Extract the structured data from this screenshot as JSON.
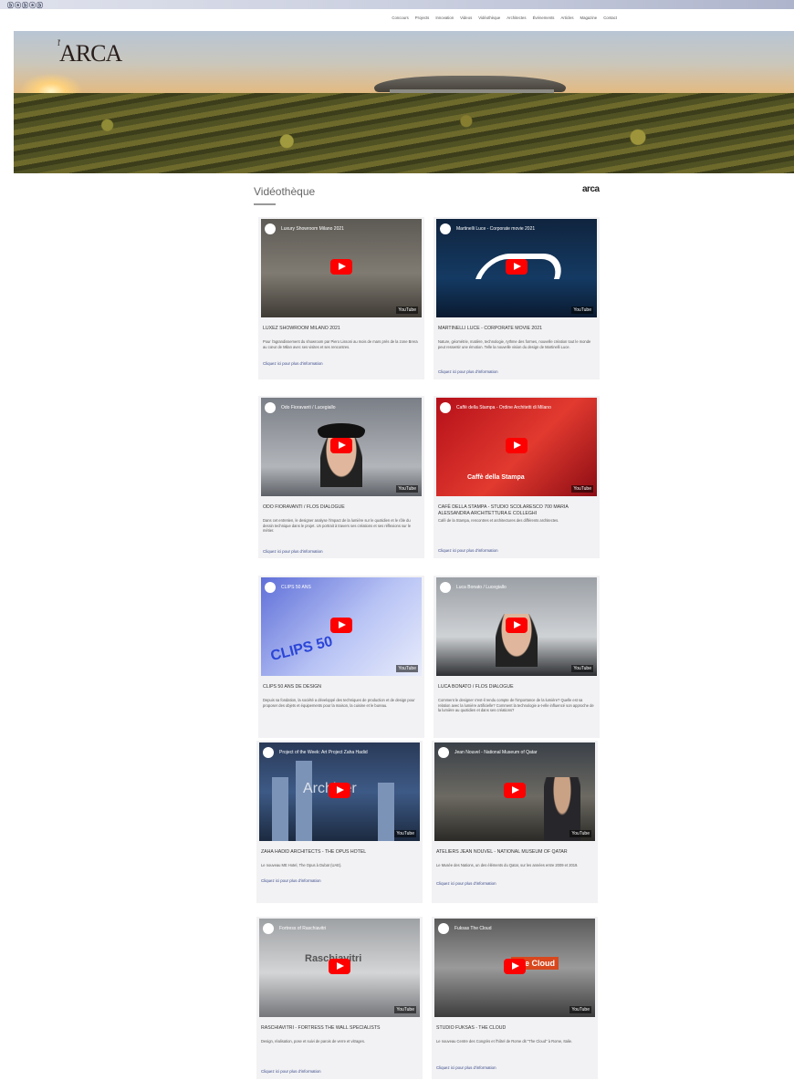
{
  "site": {
    "top_logo": "ⓑⓐⓑⓐⓑ",
    "logo_prefix": "l'",
    "logo": "ARCA",
    "nav": [
      "Concours",
      "Projects",
      "Innovation",
      "Videos",
      "Vidéothèque",
      "Architectes",
      "Événements",
      "Articles",
      "Magazine",
      "Contact"
    ]
  },
  "section": {
    "title": "Vidéothèque",
    "mark": "arca"
  },
  "cards": [
    {
      "video_title": "Luxury Showroom Milano 2021",
      "title": "LUXEZ SHOWROOM MILANO 2021",
      "desc": "Pour l'agrandissement du showroom par Piero Lissoni au mois de mars près de la zone Brera au cœur de Milan avec ses visites et ses rencontres.",
      "link": "Cliquez ici pour plus d'information",
      "theme": "t-luxury",
      "yt": "YouTube"
    },
    {
      "video_title": "Martinelli Luce - Corporate movie 2021",
      "title": "MARTINELLI LUCE - CORPORATE MOVIE 2021",
      "desc": "Nature, géométrie, matière, technologie, rythme des formes, nouvelle création tout le monde peut ressentir une émotion. Telle la nouvelle vision du design de Martinelli Luce.",
      "link": "Cliquez ici pour plus d'information",
      "theme": "t-martinelli",
      "yt": "YouTube"
    },
    {
      "video_title": "Odo Fioravanti / Lucegiallo",
      "title": "ODO FIORAVANTI / FLOS DIALOGUE",
      "desc": "Dans cet entretien, le designer analyse l'impact de la lumière sur le quotidien et le rôle du dessin technique dans le projet. Un portrait à travers ses créations et ses réflexions sur le métier.",
      "link": "Cliquez ici pour plus d'information",
      "theme": "t-odo",
      "yt": "YouTube"
    },
    {
      "video_title": "Caffè della Stampa - Ordine Architetti di Milano",
      "title": "CAFÈ DELLA STAMPA - STUDIO SCOLARESCO 700 MARIA ALESSANDRA ARCHITETTURA E COLLEGHI",
      "desc": "Café de la Stampa, rencontres et architectures des différents architectes.",
      "link": "Cliquez ici pour plus d'information",
      "theme": "t-cafe",
      "yt": "YouTube"
    },
    {
      "video_title": "CLIPS 50 ANS",
      "title": "CLIPS 50 ANS DE DESIGN",
      "desc": "Depuis sa fondation, la société a développé des techniques de production et de design pour proposer des objets et équipements pour la maison, la cuisine et le bureau.",
      "link": "",
      "theme": "t-clips",
      "yt": "YouTube"
    },
    {
      "video_title": "Luca Bonato / Lucegiallo",
      "title": "LUCA BONATO / FLOS DIALOGUE",
      "desc": "Comment le designer s'est-il rendu compte de l'importance de la lumière? Quelle est sa relation avec la lumière artificielle? Comment la technologie a-t-elle influencé son approche de la lumière au quotidien et dans ses créations?",
      "link": "",
      "theme": "t-luca",
      "yt": "YouTube"
    },
    {
      "video_title": "Project of the Week: Art Project Zaha Hadid",
      "title": "ZAHA HADID ARCHITECTS - THE OPUS HOTEL",
      "desc": "Le nouveau ME Hotel, The Opus à Dubaï (UAE).",
      "link": "Cliquez ici pour plus d'information",
      "theme": "t-zaha",
      "yt": "YouTube"
    },
    {
      "video_title": "Jean Nouvel - National Museum of Qatar",
      "title": "ATELIERS JEAN NOUVEL - NATIONAL MUSEUM OF QATAR",
      "desc": "Le Musée des Nations, un des éléments du Qatar, sur les années entre 2009 et 2019.",
      "link": "Cliquez ici pour plus d'information",
      "theme": "t-nouvel",
      "yt": "YouTube"
    },
    {
      "video_title": "Fortress of Raschiavitri",
      "title": "RASCHIAVITRI - FORTRESS THE WALL SPECIALISTS",
      "desc": "Design, réalisation, pose et suivi de parois de verre et vitrages.",
      "link": "Cliquez ici pour plus d'information",
      "theme": "t-rasch",
      "yt": "YouTube"
    },
    {
      "video_title": "Fuksas The Cloud",
      "title": "STUDIO FUKSAS - THE CLOUD",
      "desc": "Le nouveau Centre des Congrès et l'hôtel de Rome dit \"The Cloud\" à Rome, Italie.",
      "link": "Cliquez ici pour plus d'information",
      "theme": "t-cloud",
      "yt": "YouTube"
    }
  ]
}
